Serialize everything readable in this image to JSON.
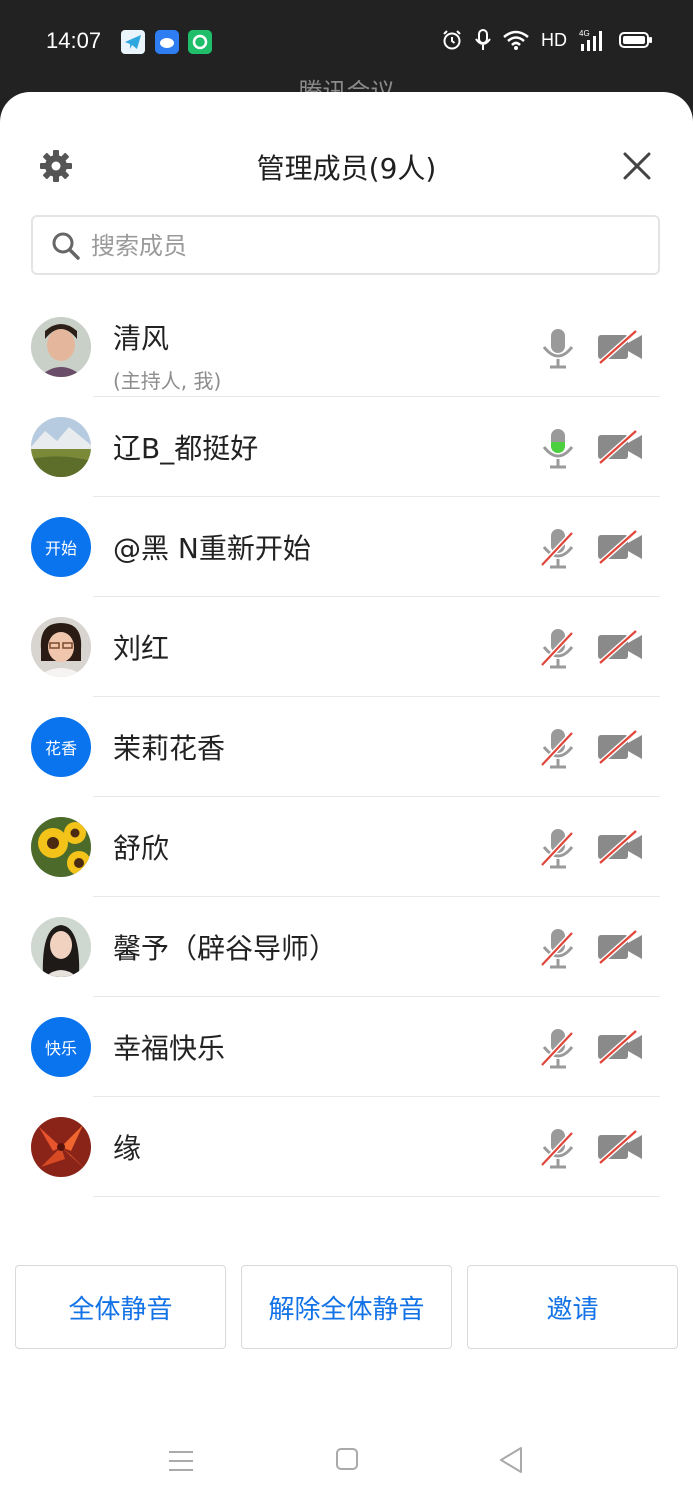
{
  "status_bar": {
    "time": "14:07",
    "network": "HD"
  },
  "background": {
    "title": "腾讯会议"
  },
  "header": {
    "title": "管理成员(9人)"
  },
  "search": {
    "placeholder": "搜索成员"
  },
  "members": [
    {
      "name": "清风",
      "role": "(主持人, 我)",
      "avatar_type": "photo",
      "mic": "off-idle",
      "camera": "off"
    },
    {
      "name": "辽B_都挺好",
      "role": "",
      "avatar_type": "photo",
      "mic": "on-speaking",
      "camera": "off"
    },
    {
      "name": "@黑 N重新开始",
      "role": "",
      "avatar_type": "text",
      "avatar_text": "开始",
      "mic": "muted",
      "camera": "off"
    },
    {
      "name": "刘红",
      "role": "",
      "avatar_type": "photo",
      "mic": "muted",
      "camera": "off"
    },
    {
      "name": "茉莉花香",
      "role": "",
      "avatar_type": "text",
      "avatar_text": "花香",
      "mic": "muted",
      "camera": "off"
    },
    {
      "name": "舒欣",
      "role": "",
      "avatar_type": "photo",
      "mic": "muted",
      "camera": "off"
    },
    {
      "name": "馨予（辟谷导师）",
      "role": "",
      "avatar_type": "photo",
      "mic": "muted",
      "camera": "off"
    },
    {
      "name": "幸福快乐",
      "role": "",
      "avatar_type": "text",
      "avatar_text": "快乐",
      "mic": "muted",
      "camera": "off"
    },
    {
      "name": "缘",
      "role": "",
      "avatar_type": "photo",
      "mic": "muted",
      "camera": "off"
    }
  ],
  "actions": {
    "mute_all": "全体静音",
    "unmute_all": "解除全体静音",
    "invite": "邀请"
  },
  "colors": {
    "accent": "#1373e6",
    "avatar_blue": "#0a73ee",
    "speaking_green": "#4cd03f",
    "muted_red": "#e0453a",
    "icon_gray": "#8a8a8a"
  }
}
